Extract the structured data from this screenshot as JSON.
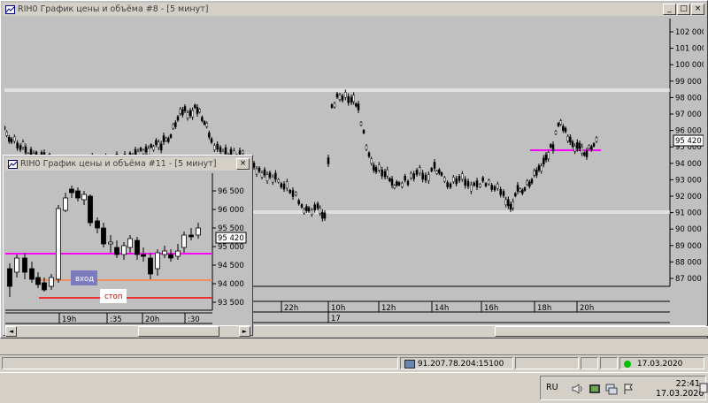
{
  "main_window": {
    "title": "RIH0 График цены и объёма #8 - [5 минут]",
    "price_ticks": [
      "102 000",
      "101 000",
      "100 000",
      "99 000",
      "98 000",
      "97 000",
      "96 000",
      "95 000",
      "94 000",
      "93 000",
      "92 000",
      "91 000",
      "90 000",
      "89 000",
      "88 000",
      "87 000"
    ],
    "price_badge": "95 420",
    "time_ticks": [
      "22h",
      "10h",
      "12h",
      "14h",
      "16h",
      "18h",
      "20h"
    ],
    "date_label": "17",
    "colors": {
      "plot_bg": "#c0c0c0",
      "candle": "#000000",
      "level_white": "#ffffff",
      "level_magenta": "#ff00ff"
    }
  },
  "sub_window": {
    "title": "RIH0 График цены и объёма #11 - [5 минут]",
    "price_ticks": [
      "96 500",
      "96 000",
      "95 500",
      "95 000",
      "94 500",
      "94 000",
      "93 500"
    ],
    "price_badge": "95 420",
    "time_ticks": [
      "19h",
      ":35",
      "20h",
      ":30"
    ],
    "entry_label": "вход",
    "stop_label": "стоп",
    "colors": {
      "entry_line": "#ff8040",
      "stop_line": "#ff0000",
      "level_magenta": "#ff00ff",
      "entry_box": "#7b7bbd"
    }
  },
  "status_bar": {
    "connection": "91.207.78.204:15100",
    "date": "17.03.2020"
  },
  "taskbar": {
    "language": "RU",
    "time": "22:41",
    "date": "17.03.2020",
    "icons": [
      "speaker-icon",
      "graphics-icon",
      "network-icon",
      "flag-icon",
      "action-center-icon"
    ]
  }
}
